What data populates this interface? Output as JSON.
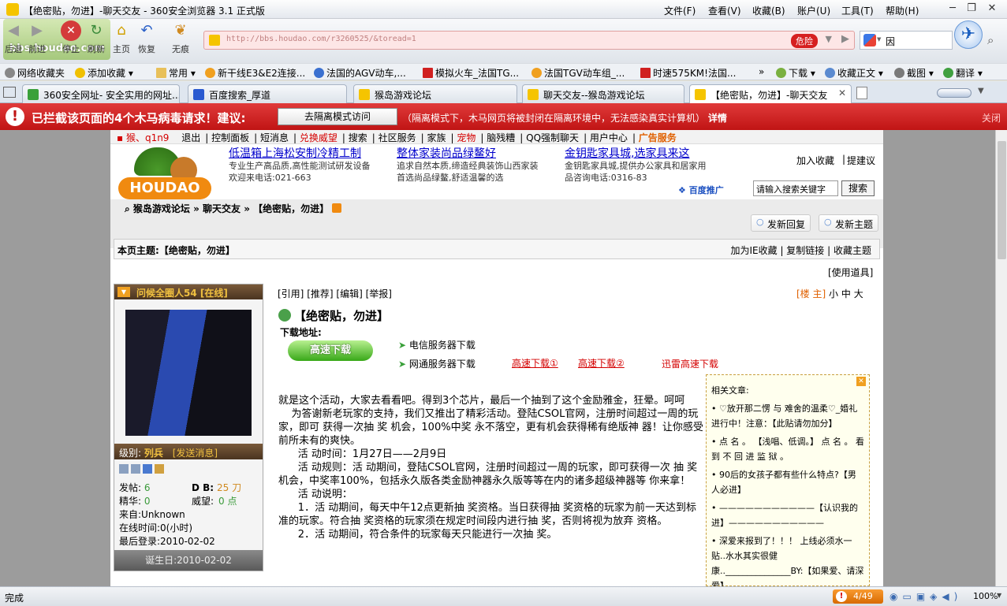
{
  "window": {
    "title": "【绝密贴，勿进】-聊天交友 - 360安全浏览器 3.1 正式版",
    "menus": [
      "文件(F)",
      "查看(V)",
      "收藏(B)",
      "账户(U)",
      "工具(T)",
      "帮助(H)"
    ]
  },
  "nav": {
    "back": "后退",
    "forward": "前进",
    "stop": "停止",
    "refresh": "刷新",
    "home": "主页",
    "restore": "恢复",
    "nomark": "无痕",
    "url": "http://bbs.houdao.com/r3260525/&toread=1",
    "danger_badge": "危险",
    "search_value": "因",
    "watermark": "bbs.houdao.com"
  },
  "bookmarks": [
    "网络收藏夹",
    "添加收藏",
    "常用",
    "新干线E3&E2连接...",
    "法国的AGV动车,...",
    "模拟火车_法国TG...",
    "法国TGV动车组_...",
    "时速575KM!法国...",
    "下载",
    "收藏正文",
    "截图",
    "翻译"
  ],
  "tabs": [
    "360安全网址- 安全实用的网址...",
    "百度搜索_厚道",
    "猴岛游戏论坛",
    "聊天交友--猴岛游戏论坛",
    "【绝密贴，勿进】-聊天交友"
  ],
  "warning": {
    "text": "已拦截该页面的4个木马病毒请求！建议:",
    "button": "去隔离模式访问",
    "desc": "（隔离模式下，木马网页将被封闭在隔离环境中，无法感染真实计算机）",
    "detail": "详情",
    "close": "关闭"
  },
  "site": {
    "topnav": {
      "user": "猴、q1n9",
      "items": [
        "退出",
        "控制面板",
        "短消息",
        "兑换威望",
        "搜索",
        "社区服务",
        "家族",
        "宠物",
        "脑残糟",
        "QQ强制聊天",
        "用户中心",
        "广告服务"
      ]
    },
    "ads": [
      {
        "title": "低温箱上海松安制冷精工制",
        "l1": "专业生产高品质,高性能测试研发设备",
        "l2": "欢迎来电话:021-663"
      },
      {
        "title": "整体家装尚品绿鳌好",
        "l1": "追求自然本质,缔造经典装饰山西家装",
        "l2": "首选尚品绿鳌,舒适温馨的选"
      },
      {
        "title": "金钥匙家具城,选家具来这",
        "l1": "金钥匙家具城,提供办公家具和居家用",
        "l2": "品咨询电话:0316-83"
      }
    ],
    "baidu": "百度推广",
    "add_fav": "加入收藏",
    "suggest": "提建议",
    "search_placeholder": "请输入搜索关键字",
    "search_button": "搜索",
    "breadcrumb": [
      "猴岛游戏论坛",
      "聊天交友",
      "【绝密贴，勿进】"
    ],
    "reply_btn": "发新回复",
    "new_topic_btn": "发新主题",
    "topic_label": "本页主题:",
    "topic_title": "【绝密贴，勿进】",
    "topic_actions": [
      "加为IE收藏",
      "复制链接",
      "收藏主题"
    ],
    "use_tools": "[使用道具]",
    "user": {
      "name": "问候全圈人54 [在线]",
      "level": "级别:",
      "rank": "列兵",
      "send_msg": "[发送消息]",
      "posts_label": "发帖:",
      "posts": "6",
      "db_label": "D B:",
      "db": "25 刀",
      "elite_label": "精华:",
      "elite": "0",
      "rep_label": "威望:",
      "rep": "0 点",
      "from": "来自:Unknown",
      "online": "在线时间:0(小时)",
      "last_login": "最后登录:2010-02-02",
      "birthday": "诞生日:2010-02-02"
    },
    "post": {
      "actions": [
        "[引用]",
        "[推荐]",
        "[编辑]",
        "[举报]"
      ],
      "floor": "[楼 主]",
      "sizes": [
        "小",
        "中",
        "大"
      ],
      "title": "【绝密贴，勿进】",
      "download_label": "下载地址:",
      "fast_download": "高速下载",
      "telecom": "电信服务器下载",
      "netcom": "网通服务器下载",
      "dl1": "高速下载①",
      "dl2": "高速下载②",
      "thunder": "迅雷高速下载",
      "body": [
        "就是这个活动，大家去看看吧。得到3个芯片，最后一个抽到了这个金励雅金，狂晕。呵呵",
        "    为答谢新老玩家的支持，我们又推出了精彩活动。登陆CSOL官网，注册时间超过一周的玩家，即可 获得一次抽 奖 机会，100%中奖 永不落空，更有机会获得稀有绝版神 器！让你感受前所未有的爽快。",
        "      活 动时间：1月27日——2月9日",
        "      活 动规则：活 动期间，登陆CSOL官网，注册时间超过一周的玩家，即可获得一次 抽 奖机会，中奖率100%，包括永久版各类金励神器永久版等等在内的诸多超级神器等 你来拿！",
        "      活 动说明：",
        "      1．活 动期间，每天中午12点更新抽 奖资格。当日获得抽 奖资格的玩家为前一天达到标准的玩家。符合抽 奖资格的玩家须在规定时间段内进行抽 奖，否则将视为放弃 资格。",
        "      2．活 动期间，符合条件的玩家每天只能进行一次抽 奖。"
      ]
    },
    "related": {
      "title": "相关文章:",
      "items": [
        "♡放开那二愣 与 难舍的温柔♡_婚礼进行中！注意：【此贴请勿加分】",
        "点 名 。 【浅唱、低调。】 点 名 。 看 到 不 回 进 监 狱 。",
        "90后的女孩子都有些什么特点?【男人必进】",
        "———————————【认识我的进】———————————",
        "深爱来报到了！！！ 上线必须水一贴..水水其实很健康.._______________BY:【如果爱、请深爱】"
      ]
    }
  },
  "status": {
    "text": "完成",
    "badge": "4/49",
    "zoom": "100%"
  }
}
